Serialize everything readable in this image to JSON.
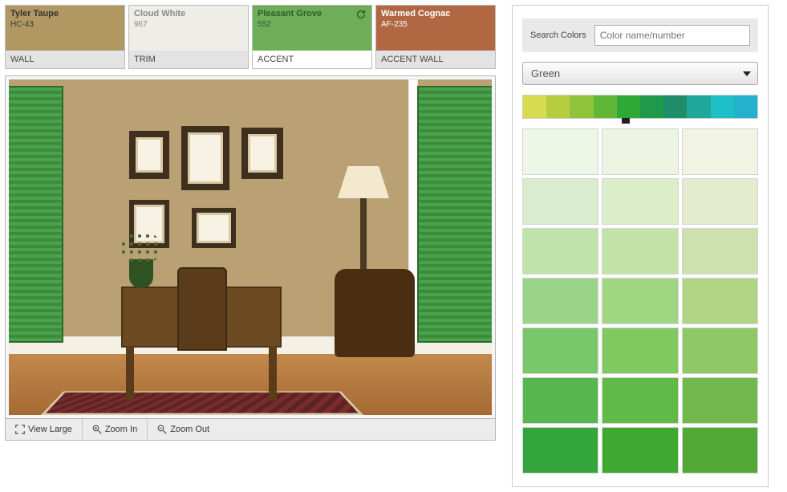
{
  "swatches": [
    {
      "name": "Tyler Taupe",
      "code": "HC-43",
      "role": "WALL",
      "color": "#b19862",
      "text": "#333333",
      "active": false
    },
    {
      "name": "Cloud White",
      "code": "967",
      "role": "TRIM",
      "color": "#eeede7",
      "text": "#888888",
      "active": false
    },
    {
      "name": "Pleasant Grove",
      "code": "552",
      "role": "ACCENT",
      "color": "#6eae58",
      "text": "#2a5e28",
      "active": true,
      "refresh": true
    },
    {
      "name": "Warmed Cognac",
      "code": "AF-235",
      "role": "ACCENT WALL",
      "color": "#b16842",
      "text": "#ffffff",
      "active": false
    }
  ],
  "toolbar": {
    "view_large": "View Large",
    "zoom_in": "Zoom In",
    "zoom_out": "Zoom Out"
  },
  "search": {
    "label": "Search Colors",
    "placeholder": "Color name/number"
  },
  "family_selected": "Green",
  "hue_colors": [
    "#d7db4f",
    "#b7cd3f",
    "#8fc33a",
    "#5fb637",
    "#2fa936",
    "#1f9a4a",
    "#1f8d6a",
    "#1fa89a",
    "#1fbfc7",
    "#23b1cc"
  ],
  "palette": [
    "#eef6e6",
    "#edf4e1",
    "#f1f4e2",
    "#d9edce",
    "#dbedc9",
    "#e4ebcf",
    "#c0e3ac",
    "#c3e3a8",
    "#cfe0af",
    "#99d488",
    "#a0d682",
    "#b0d587",
    "#78c76b",
    "#7fc95f",
    "#8fc966",
    "#57b650",
    "#61b947",
    "#71b94d",
    "#33a53a",
    "#3fa830",
    "#52a935"
  ]
}
